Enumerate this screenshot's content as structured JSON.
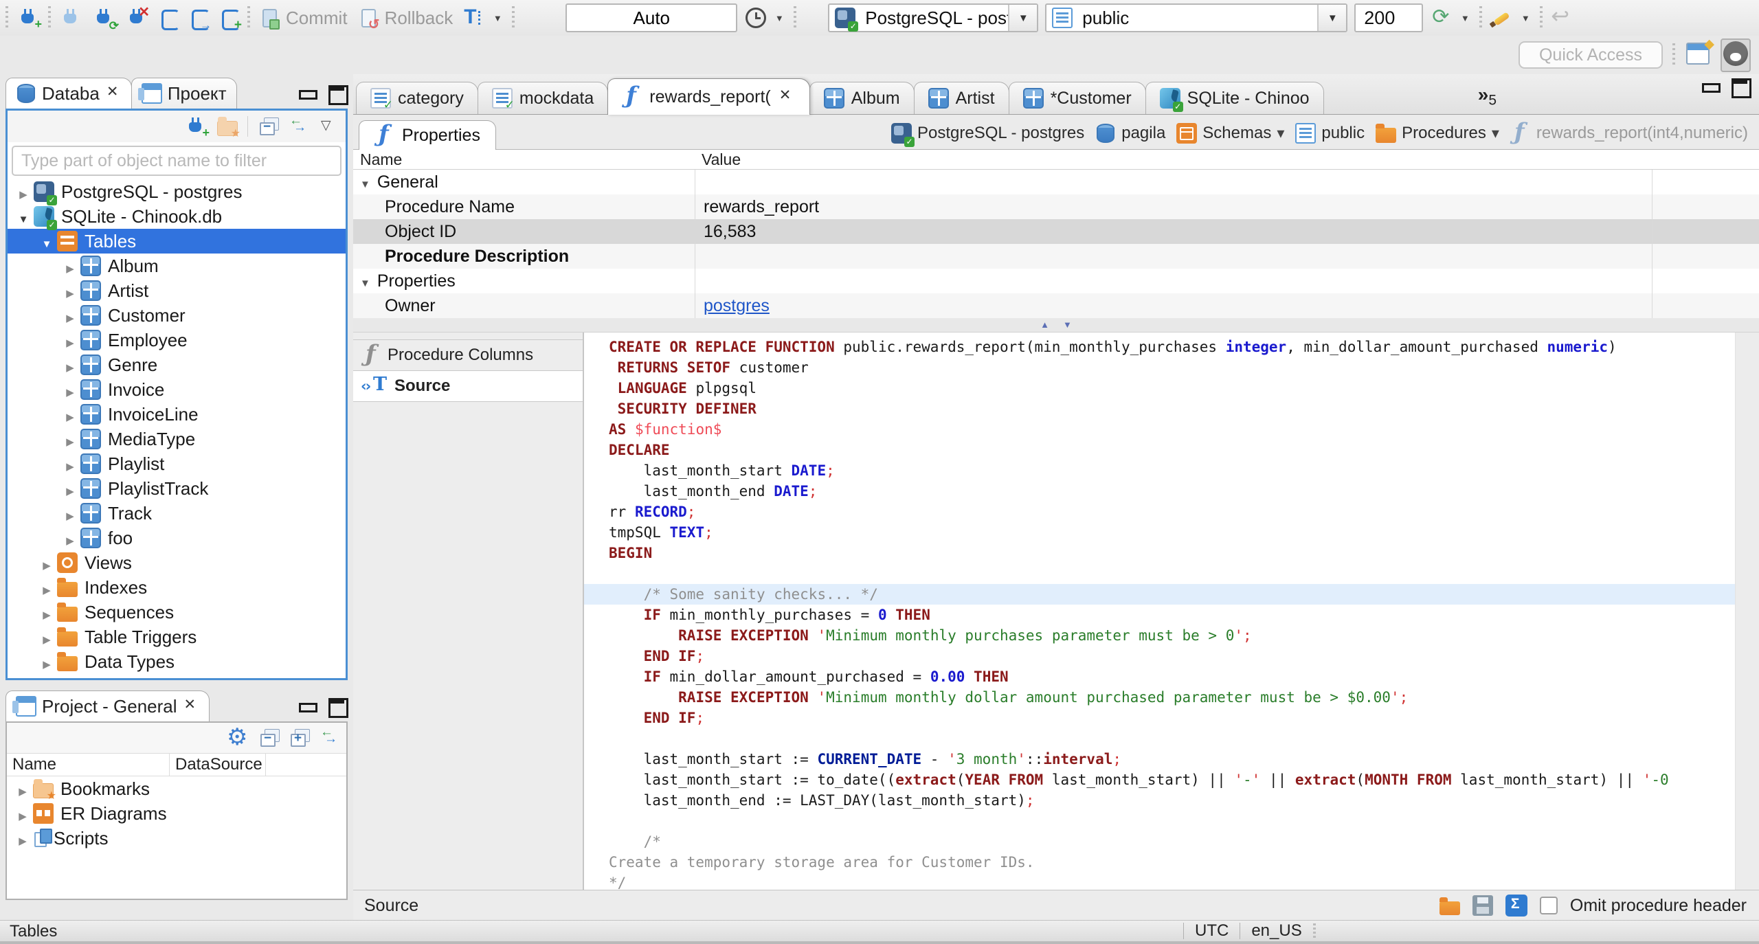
{
  "window": {
    "quick_access_placeholder": "Quick Access",
    "tab_overflow_count": "5"
  },
  "toolbar": {
    "commit_label": "Commit",
    "rollback_label": "Rollback",
    "transaction_mode": "Auto",
    "connection": "PostgreSQL - postgres",
    "schema": "public",
    "fetch_size": "200"
  },
  "sidebar": {
    "tabs": [
      {
        "label": "Databa"
      },
      {
        "label": "Проект"
      }
    ],
    "filter_placeholder": "Type part of object name to filter",
    "tree": [
      {
        "label": "PostgreSQL - postgres",
        "icon": "postgres",
        "level": 0,
        "exp": "c"
      },
      {
        "label": "SQLite - Chinook.db",
        "icon": "sqlite",
        "level": 0,
        "exp": "e"
      },
      {
        "label": "Tables",
        "icon": "tables",
        "level": 1,
        "exp": "e",
        "selected": true
      },
      {
        "label": "Album",
        "icon": "table",
        "level": 2,
        "exp": "c"
      },
      {
        "label": "Artist",
        "icon": "table",
        "level": 2,
        "exp": "c"
      },
      {
        "label": "Customer",
        "icon": "table",
        "level": 2,
        "exp": "c"
      },
      {
        "label": "Employee",
        "icon": "table",
        "level": 2,
        "exp": "c"
      },
      {
        "label": "Genre",
        "icon": "table",
        "level": 2,
        "exp": "c"
      },
      {
        "label": "Invoice",
        "icon": "table",
        "level": 2,
        "exp": "c"
      },
      {
        "label": "InvoiceLine",
        "icon": "table",
        "level": 2,
        "exp": "c"
      },
      {
        "label": "MediaType",
        "icon": "table",
        "level": 2,
        "exp": "c"
      },
      {
        "label": "Playlist",
        "icon": "table",
        "level": 2,
        "exp": "c"
      },
      {
        "label": "PlaylistTrack",
        "icon": "table",
        "level": 2,
        "exp": "c"
      },
      {
        "label": "Track",
        "icon": "table",
        "level": 2,
        "exp": "c"
      },
      {
        "label": "foo",
        "icon": "table",
        "level": 2,
        "exp": "c"
      },
      {
        "label": "Views",
        "icon": "views",
        "level": 1,
        "exp": "c"
      },
      {
        "label": "Indexes",
        "icon": "folder",
        "level": 1,
        "exp": "c"
      },
      {
        "label": "Sequences",
        "icon": "folder",
        "level": 1,
        "exp": "c"
      },
      {
        "label": "Table Triggers",
        "icon": "folder",
        "level": 1,
        "exp": "c"
      },
      {
        "label": "Data Types",
        "icon": "folder",
        "level": 1,
        "exp": "c"
      }
    ]
  },
  "project_panel": {
    "tab_label": "Project - General",
    "columns": [
      "Name",
      "DataSource"
    ],
    "items": [
      {
        "label": "Bookmarks",
        "icon": "bookmarks"
      },
      {
        "label": "ER Diagrams",
        "icon": "er"
      },
      {
        "label": "Scripts",
        "icon": "scripts"
      }
    ]
  },
  "editor_tabs": [
    {
      "label": "category",
      "icon": "sqlfile"
    },
    {
      "label": "mockdata",
      "icon": "sqlfile"
    },
    {
      "label": "rewards_report(",
      "icon": "fn",
      "active": true
    },
    {
      "label": "Album",
      "icon": "table"
    },
    {
      "label": "Artist",
      "icon": "table"
    },
    {
      "label": "*Customer",
      "icon": "table"
    },
    {
      "label": "SQLite - Chinoo",
      "icon": "sqlite"
    }
  ],
  "properties_view": {
    "tab_label": "Properties",
    "breadcrumb": [
      {
        "label": "PostgreSQL - postgres",
        "icon": "postgres"
      },
      {
        "label": "pagila",
        "icon": "dbcyl"
      },
      {
        "label": "Schemas",
        "icon": "schemas",
        "dd": true
      },
      {
        "label": "public",
        "icon": "page"
      },
      {
        "label": "Procedures",
        "icon": "folder",
        "dd": true
      },
      {
        "label": "rewards_report(int4,numeric)",
        "icon": "fn muted",
        "muted": true
      }
    ],
    "grid": {
      "columns": [
        "Name",
        "Value"
      ],
      "rows": [
        {
          "name": "General",
          "type": "group",
          "value": ""
        },
        {
          "name": "Procedure Name",
          "value": "rewards_report"
        },
        {
          "name": "Object ID",
          "value": "16,583",
          "selected": true
        },
        {
          "name": "Procedure Description",
          "value": "",
          "bold": true
        },
        {
          "name": "Properties",
          "type": "group",
          "value": ""
        },
        {
          "name": "Owner",
          "value": "postgres",
          "link": true
        }
      ]
    }
  },
  "subtabs": [
    {
      "label": "Procedure Columns",
      "icon": "fn gray"
    },
    {
      "label": "Source",
      "icon": "srct",
      "active": true
    }
  ],
  "source": {
    "highlight_line": 12,
    "lines": [
      [
        [
          "k",
          "CREATE OR REPLACE FUNCTION"
        ],
        [
          "p",
          " public.rewards_report(min_monthly_purchases "
        ],
        [
          "t",
          "integer"
        ],
        [
          "p",
          ", min_dollar_amount_purchased "
        ],
        [
          "t",
          "numeric"
        ],
        [
          "p",
          ")"
        ]
      ],
      [
        [
          "p",
          " "
        ],
        [
          "k",
          "RETURNS SETOF"
        ],
        [
          "p",
          " customer"
        ]
      ],
      [
        [
          "p",
          " "
        ],
        [
          "k",
          "LANGUAGE"
        ],
        [
          "p",
          " plpgsql"
        ]
      ],
      [
        [
          "p",
          " "
        ],
        [
          "k",
          "SECURITY DEFINER"
        ]
      ],
      [
        [
          "k",
          "AS"
        ],
        [
          "p",
          " "
        ],
        [
          "d",
          "$function$"
        ]
      ],
      [
        [
          "k",
          "DECLARE"
        ]
      ],
      [
        [
          "p",
          "    last_month_start "
        ],
        [
          "t",
          "DATE"
        ],
        [
          "x",
          ";"
        ]
      ],
      [
        [
          "p",
          "    last_month_end "
        ],
        [
          "t",
          "DATE"
        ],
        [
          "x",
          ";"
        ]
      ],
      [
        [
          "p",
          "rr "
        ],
        [
          "t",
          "RECORD"
        ],
        [
          "x",
          ";"
        ]
      ],
      [
        [
          "p",
          "tmpSQL "
        ],
        [
          "t",
          "TEXT"
        ],
        [
          "x",
          ";"
        ]
      ],
      [
        [
          "k",
          "BEGIN"
        ]
      ],
      [],
      [
        [
          "p",
          "    "
        ],
        [
          "c",
          "/* Some sanity checks... */"
        ]
      ],
      [
        [
          "p",
          "    "
        ],
        [
          "k",
          "IF"
        ],
        [
          "p",
          " min_monthly_purchases = "
        ],
        [
          "t",
          "0"
        ],
        [
          "p",
          " "
        ],
        [
          "k",
          "THEN"
        ]
      ],
      [
        [
          "p",
          "        "
        ],
        [
          "k",
          "RAISE EXCEPTION"
        ],
        [
          "p",
          " "
        ],
        [
          "q",
          "'"
        ],
        [
          "s",
          "Minimum monthly purchases parameter must be > 0"
        ],
        [
          "q",
          "'"
        ],
        [
          "x",
          ";"
        ]
      ],
      [
        [
          "p",
          "    "
        ],
        [
          "k",
          "END IF"
        ],
        [
          "x",
          ";"
        ]
      ],
      [
        [
          "p",
          "    "
        ],
        [
          "k",
          "IF"
        ],
        [
          "p",
          " min_dollar_amount_purchased = "
        ],
        [
          "t",
          "0.00"
        ],
        [
          "p",
          " "
        ],
        [
          "k",
          "THEN"
        ]
      ],
      [
        [
          "p",
          "        "
        ],
        [
          "k",
          "RAISE EXCEPTION"
        ],
        [
          "p",
          " "
        ],
        [
          "q",
          "'"
        ],
        [
          "s",
          "Minimum monthly dollar amount purchased parameter must be > $0.00"
        ],
        [
          "q",
          "'"
        ],
        [
          "x",
          ";"
        ]
      ],
      [
        [
          "p",
          "    "
        ],
        [
          "k",
          "END IF"
        ],
        [
          "x",
          ";"
        ]
      ],
      [],
      [
        [
          "p",
          "    last_month_start := "
        ],
        [
          "n",
          "CURRENT_DATE"
        ],
        [
          "p",
          " - "
        ],
        [
          "q",
          "'"
        ],
        [
          "s",
          "3 month"
        ],
        [
          "q",
          "'"
        ],
        [
          "p",
          "::"
        ],
        [
          "k",
          "interval"
        ],
        [
          "x",
          ";"
        ]
      ],
      [
        [
          "p",
          "    last_month_start := to_date(("
        ],
        [
          "k",
          "extract"
        ],
        [
          "p",
          "("
        ],
        [
          "k",
          "YEAR FROM"
        ],
        [
          "p",
          " last_month_start) || "
        ],
        [
          "q",
          "'"
        ],
        [
          "s",
          "-"
        ],
        [
          "q",
          "'"
        ],
        [
          "p",
          " || "
        ],
        [
          "k",
          "extract"
        ],
        [
          "p",
          "("
        ],
        [
          "k",
          "MONTH FROM"
        ],
        [
          "p",
          " last_month_start) || "
        ],
        [
          "q",
          "'"
        ],
        [
          "s",
          "-0"
        ]
      ],
      [
        [
          "p",
          "    last_month_end := LAST_DAY(last_month_start)"
        ],
        [
          "x",
          ";"
        ]
      ],
      [],
      [
        [
          "p",
          "    "
        ],
        [
          "c",
          "/*"
        ]
      ],
      [
        [
          "c",
          "Create a temporary storage area for Customer IDs."
        ]
      ],
      [
        [
          "c",
          "*/"
        ]
      ]
    ]
  },
  "editor_footer": {
    "label": "Source",
    "omit_label": "Omit procedure header"
  },
  "status_bar": {
    "left": "Tables",
    "timezone": "UTC",
    "locale": "en_US"
  },
  "colors": {
    "selection": "#3173de",
    "focus_border": "#4a8fd3",
    "link": "#1f56c8",
    "keyword": "#8b1a1a",
    "type": "#1a1ace",
    "string": "#2a7d2a",
    "comment": "#8f8f8f"
  }
}
